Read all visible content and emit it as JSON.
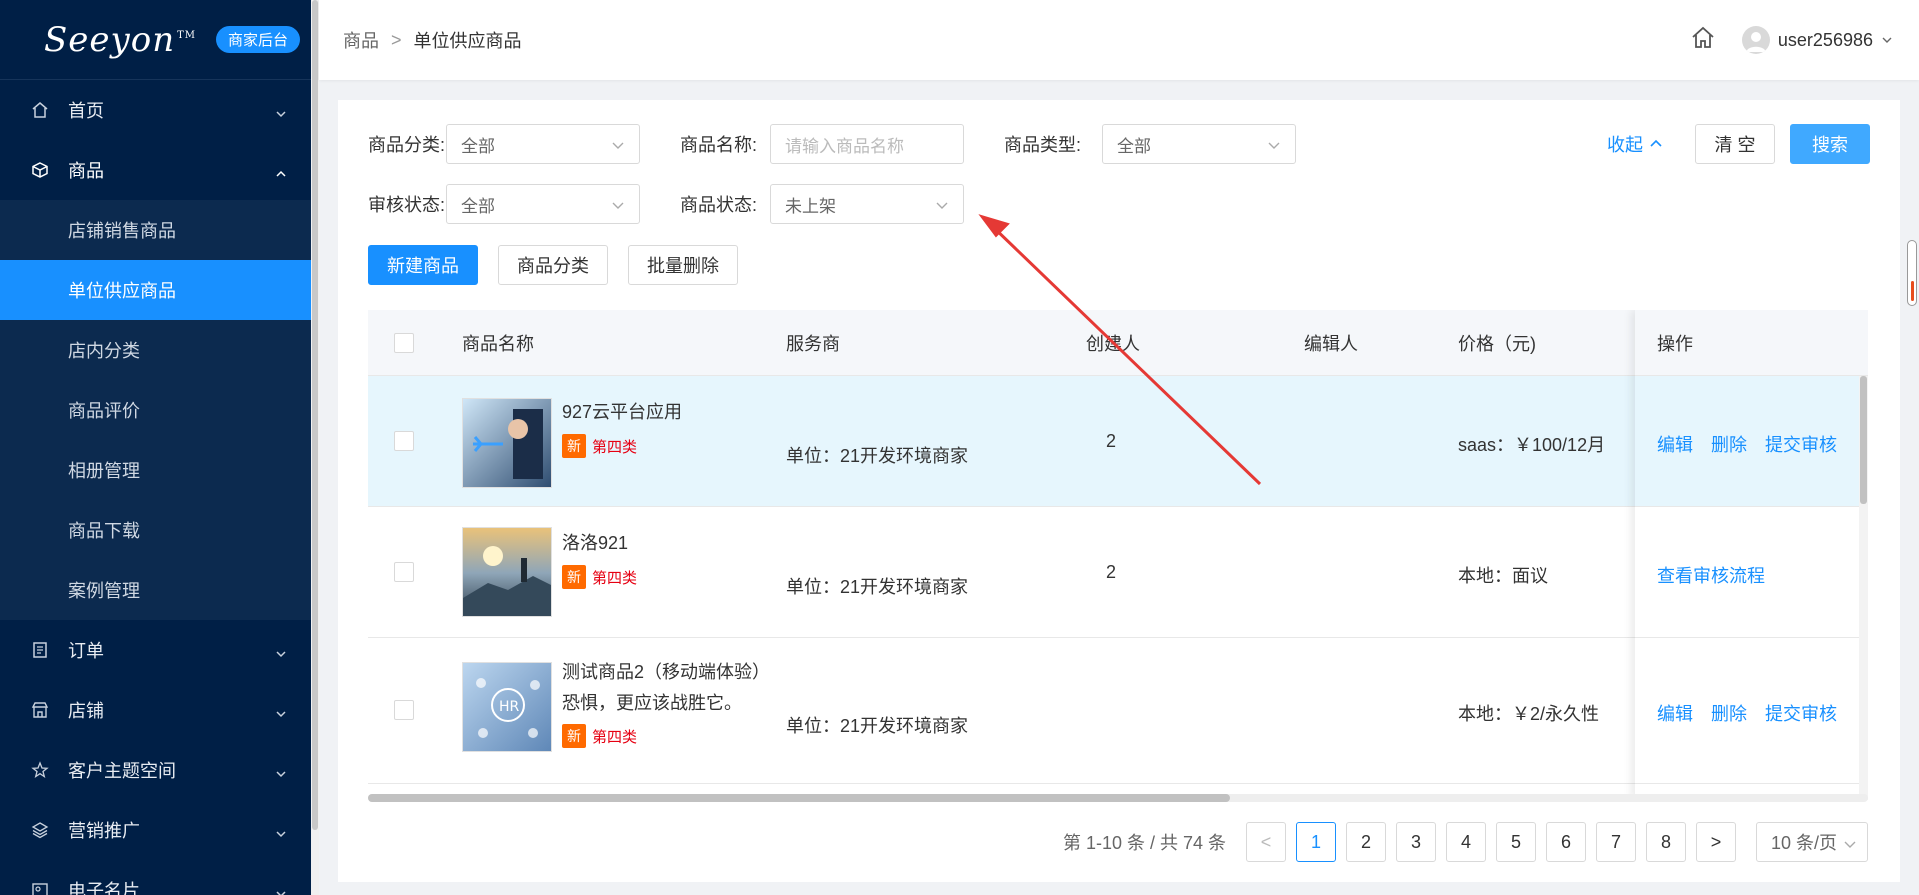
{
  "sidebar": {
    "logo": "Seeyon",
    "logo_tm": "TM",
    "badge": "商家后台",
    "items": [
      {
        "label": "首页",
        "icon": "home-icon"
      },
      {
        "label": "商品",
        "icon": "cube-icon"
      },
      {
        "label": "订单",
        "icon": "document-icon"
      },
      {
        "label": "店铺",
        "icon": "store-icon"
      },
      {
        "label": "客户主题空间",
        "icon": "star-icon"
      },
      {
        "label": "营销推广",
        "icon": "layers-icon"
      },
      {
        "label": "电子名片",
        "icon": "card-icon"
      }
    ],
    "sub_items": [
      "店铺销售商品",
      "单位供应商品",
      "店内分类",
      "商品评价",
      "相册管理",
      "商品下载",
      "案例管理"
    ],
    "active_sub": "单位供应商品"
  },
  "header": {
    "breadcrumb_root": "商品",
    "breadcrumb_sep": ">",
    "breadcrumb_current": "单位供应商品",
    "username": "user256986"
  },
  "filters": {
    "category_label": "商品分类:",
    "category_value": "全部",
    "name_label": "商品名称:",
    "name_placeholder": "请输入商品名称",
    "type_label": "商品类型:",
    "type_value": "全部",
    "audit_label": "审核状态:",
    "audit_value": "全部",
    "status_label": "商品状态:",
    "status_value": "未上架",
    "collapse": "收起",
    "clear": "清 空",
    "search": "搜索"
  },
  "actions": {
    "new_product": "新建商品",
    "product_category": "商品分类",
    "batch_delete": "批量删除"
  },
  "table": {
    "columns": [
      "商品名称",
      "服务商",
      "创建人",
      "编辑人",
      "价格（元)",
      "操作"
    ],
    "rows": [
      {
        "name": "927云平台应用",
        "desc": "",
        "tag_new": "新",
        "tag_cat": "第四类",
        "provider": "单位：21开发环境商家",
        "creator": "2",
        "editor": "",
        "price": "saas：￥100/12月",
        "ops": [
          "编辑",
          "删除",
          "提交审核"
        ]
      },
      {
        "name": "洛洛921",
        "desc": "",
        "tag_new": "新",
        "tag_cat": "第四类",
        "provider": "单位：21开发环境商家",
        "creator": "2",
        "editor": "",
        "price": "本地：面议",
        "ops": [
          "查看审核流程"
        ]
      },
      {
        "name": "测试商品2（移动端体验）",
        "desc": "恐惧，更应该战胜它。",
        "tag_new": "新",
        "tag_cat": "第四类",
        "provider": "单位：21开发环境商家",
        "creator": "",
        "editor": "",
        "price": "本地：￥2/永久性",
        "ops": [
          "编辑",
          "删除",
          "提交审核"
        ]
      }
    ]
  },
  "pagination": {
    "total_text": "第 1-10 条 / 共 74 条",
    "prev": "<",
    "next": ">",
    "pages": [
      "1",
      "2",
      "3",
      "4",
      "5",
      "6",
      "7",
      "8"
    ],
    "current": "1",
    "page_size": "10 条/页"
  },
  "colors": {
    "sidebar_bg": "#001f46",
    "primary": "#1890ff",
    "tag_new": "#ff6a00",
    "tag_cat": "#e60012",
    "annotation_arrow": "#e53935"
  }
}
